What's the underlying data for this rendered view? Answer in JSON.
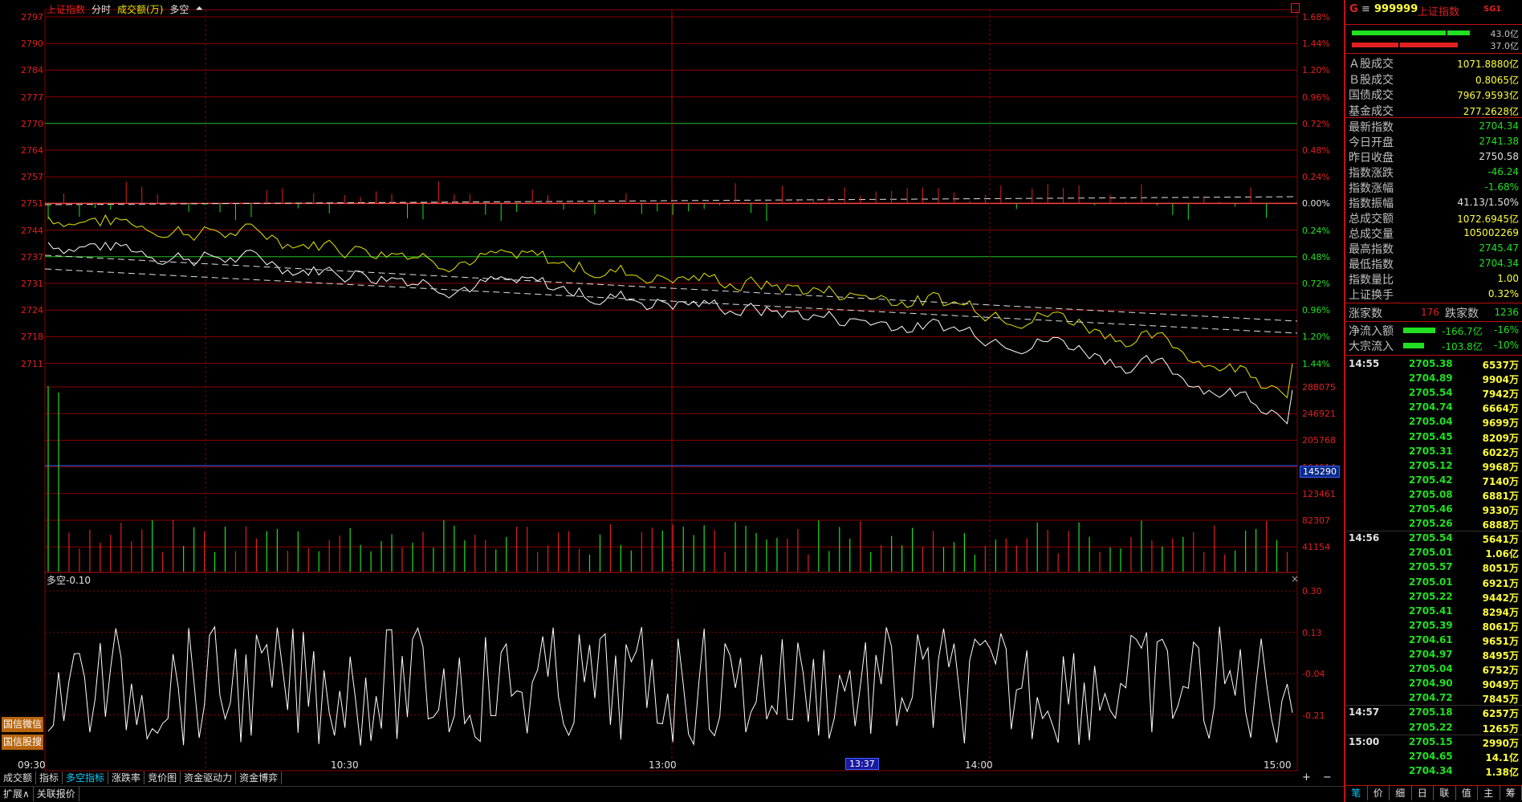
{
  "header": {
    "index_name": "上证指数",
    "view": "分时",
    "metric": "成交额(万)",
    "indicator": "多空",
    "arrow_icon": "triangle-up-icon"
  },
  "price_axis": {
    "left_ticks": [
      "2797",
      "2790",
      "2784",
      "2777",
      "2770",
      "2764",
      "2757",
      "2751",
      "2744",
      "2737",
      "2731",
      "2724",
      "2718",
      "2711"
    ],
    "right_ticks": [
      "1.68%",
      "1.44%",
      "1.20%",
      "0.96%",
      "0.72%",
      "0.48%",
      "0.24%",
      "0.00%",
      "0.24%",
      "0.48%",
      "0.72%",
      "0.96%",
      "1.20%",
      "1.44%"
    ]
  },
  "volume_axis": {
    "ticks": [
      "288075",
      "246921",
      "205768",
      "164614",
      "123461",
      "82307",
      "41154"
    ],
    "cursor_value": "145290"
  },
  "indicator_panel": {
    "label": "多空-0.10",
    "close_label": "×",
    "ticks": [
      "0.30",
      "0.13",
      "-0.04",
      "-0.21"
    ]
  },
  "left_buttons": [
    "国信微信",
    "国信股搜"
  ],
  "time_axis": {
    "labels": [
      "09:30",
      "10:30",
      "13:00",
      "14:00",
      "15:00"
    ],
    "cursor_time": "13:37"
  },
  "bottom_tabs": [
    "成交额",
    "指标",
    "多空指标",
    "涨跌率",
    "竞价图",
    "资金驱动力",
    "资金博弈"
  ],
  "active_tab": "多空指标",
  "tab_controls": [
    "+",
    "−"
  ],
  "status_bar": [
    "扩展∧",
    "关联报价"
  ],
  "right_panel": {
    "market_letter": "G",
    "menu_icon": "menu-icon",
    "code": "999999",
    "name": "上证指数",
    "tag": "SG1",
    "ratio_up": "43.0亿",
    "ratio_down": "37.0亿",
    "turnover": [
      {
        "label": "Ａ股成交",
        "value": "1071.8880亿"
      },
      {
        "label": "Ｂ股成交",
        "value": "0.8065亿"
      },
      {
        "label": "国债成交",
        "value": "7967.9593亿"
      },
      {
        "label": "基金成交",
        "value": "277.2628亿"
      }
    ],
    "stats": [
      {
        "label": "最新指数",
        "value": "2704.34",
        "color": "#20e020"
      },
      {
        "label": "今日开盘",
        "value": "2741.38",
        "color": "#20e020"
      },
      {
        "label": "昨日收盘",
        "value": "2750.58",
        "color": "#e0e0e0"
      },
      {
        "label": "指数涨跌",
        "value": "-46.24",
        "color": "#20e020"
      },
      {
        "label": "指数涨幅",
        "value": "-1.68%",
        "color": "#20e020"
      },
      {
        "label": "指数振幅",
        "value": "41.13/1.50%",
        "color": "#e0e0e0"
      },
      {
        "label": "总成交额",
        "value": "1072.6945亿",
        "color": "#ffff40"
      },
      {
        "label": "总成交量",
        "value": "105002269",
        "color": "#ffff40"
      },
      {
        "label": "最高指数",
        "value": "2745.47",
        "color": "#20e020"
      },
      {
        "label": "最低指数",
        "value": "2704.34",
        "color": "#20e020"
      },
      {
        "label": "指数量比",
        "value": "1.00",
        "color": "#ffff40"
      },
      {
        "label": "上证换手",
        "value": "0.32%",
        "color": "#ffff40"
      }
    ],
    "breadth": {
      "up_label": "涨家数",
      "up": "176",
      "down_label": "跌家数",
      "down": "1236"
    },
    "flows": [
      {
        "label": "净流入额",
        "value": "-166.7亿",
        "pct": "-16%"
      },
      {
        "label": "大宗流入",
        "value": "-103.8亿",
        "pct": "-10%"
      }
    ],
    "ticks": [
      {
        "time": "14:55",
        "price": "2705.38",
        "vol": "6537万"
      },
      {
        "time": "",
        "price": "2704.89",
        "vol": "9904万"
      },
      {
        "time": "",
        "price": "2705.54",
        "vol": "7942万"
      },
      {
        "time": "",
        "price": "2704.74",
        "vol": "6664万"
      },
      {
        "time": "",
        "price": "2705.04",
        "vol": "9699万"
      },
      {
        "time": "",
        "price": "2705.45",
        "vol": "8209万"
      },
      {
        "time": "",
        "price": "2705.31",
        "vol": "6022万"
      },
      {
        "time": "",
        "price": "2705.12",
        "vol": "9968万"
      },
      {
        "time": "",
        "price": "2705.42",
        "vol": "7140万"
      },
      {
        "time": "",
        "price": "2705.08",
        "vol": "6881万"
      },
      {
        "time": "",
        "price": "2705.46",
        "vol": "9330万"
      },
      {
        "time": "",
        "price": "2705.26",
        "vol": "6888万"
      },
      {
        "time": "14:56",
        "price": "2705.54",
        "vol": "5641万"
      },
      {
        "time": "",
        "price": "2705.01",
        "vol": "1.06亿"
      },
      {
        "time": "",
        "price": "2705.57",
        "vol": "8051万"
      },
      {
        "time": "",
        "price": "2705.01",
        "vol": "6921万"
      },
      {
        "time": "",
        "price": "2705.22",
        "vol": "9442万"
      },
      {
        "time": "",
        "price": "2705.41",
        "vol": "8294万"
      },
      {
        "time": "",
        "price": "2705.39",
        "vol": "8061万"
      },
      {
        "time": "",
        "price": "2704.61",
        "vol": "9651万"
      },
      {
        "time": "",
        "price": "2704.97",
        "vol": "8495万"
      },
      {
        "time": "",
        "price": "2705.04",
        "vol": "6752万"
      },
      {
        "time": "",
        "price": "2704.90",
        "vol": "9049万"
      },
      {
        "time": "",
        "price": "2704.72",
        "vol": "7845万"
      },
      {
        "time": "14:57",
        "price": "2705.18",
        "vol": "6257万"
      },
      {
        "time": "",
        "price": "2705.22",
        "vol": "1265万"
      },
      {
        "time": "15:00",
        "price": "2705.15",
        "vol": "2990万"
      },
      {
        "time": "",
        "price": "2704.65",
        "vol": "14.1亿"
      },
      {
        "time": "",
        "price": "2704.34",
        "vol": "1.38亿"
      }
    ],
    "bottom_tabs": [
      "笔",
      "价",
      "细",
      "日",
      "联",
      "值",
      "主",
      "筹"
    ]
  },
  "colors": {
    "up": "#e02020",
    "down": "#20e020",
    "grid": "#8b0000",
    "price_line": "#ffffff",
    "avg_line": "#e6e600",
    "active_tab": "#00d0ff"
  },
  "chart_data": {
    "type": "line",
    "title": "上证指数",
    "x": [
      "09:30",
      "10:30",
      "13:00",
      "14:00",
      "15:00"
    ],
    "series": [],
    "ylim": [
      2704.34,
      2797
    ],
    "prev_close": 2750.58,
    "volume_ylim": [
      0,
      288075
    ],
    "indicator_ylim": [
      -0.21,
      0.3
    ],
    "indicator_current": -0.1
  }
}
